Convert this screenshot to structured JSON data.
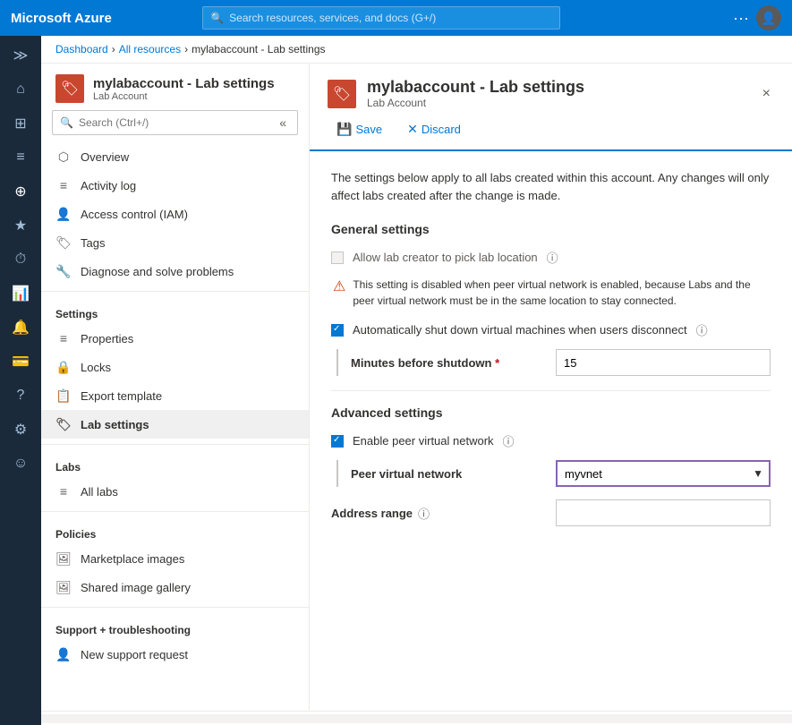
{
  "topbar": {
    "brand": "Microsoft Azure",
    "search_placeholder": "Search resources, services, and docs (G+/)"
  },
  "breadcrumb": {
    "items": [
      "Dashboard",
      "All resources",
      "mylabaccount - Lab settings"
    ]
  },
  "panel": {
    "title": "mylabaccount - Lab settings",
    "subtitle": "Lab Account",
    "close_label": "×"
  },
  "toolbar": {
    "save_label": "Save",
    "discard_label": "Discard"
  },
  "description": "The settings below apply to all labs created within this account. Any changes will only affect labs created after the change is made.",
  "general_settings": {
    "title": "General settings",
    "allow_lab_creator_label": "Allow lab creator to pick lab location",
    "warning_text": "This setting is disabled when peer virtual network is enabled, because Labs and the peer virtual network must be in the same location to stay connected.",
    "auto_shutdown_label": "Automatically shut down virtual machines when users disconnect",
    "minutes_label": "Minutes before shutdown",
    "minutes_required": true,
    "minutes_value": "15"
  },
  "advanced_settings": {
    "title": "Advanced settings",
    "enable_peer_vnet_label": "Enable peer virtual network",
    "peer_vnet_label": "Peer virtual network",
    "peer_vnet_value": "myvnet",
    "peer_vnet_options": [
      "myvnet"
    ],
    "address_range_label": "Address range",
    "address_range_value": ""
  },
  "sidebar": {
    "title": "mylabaccount - Lab settings",
    "subtitle": "Lab Account",
    "search_placeholder": "Search (Ctrl+/)",
    "items": [
      {
        "id": "overview",
        "label": "Overview",
        "icon": "⬡"
      },
      {
        "id": "activity-log",
        "label": "Activity log",
        "icon": "≡"
      },
      {
        "id": "access-control",
        "label": "Access control (IAM)",
        "icon": "👤"
      },
      {
        "id": "tags",
        "label": "Tags",
        "icon": "🏷"
      },
      {
        "id": "diagnose",
        "label": "Diagnose and solve problems",
        "icon": "🔧"
      }
    ],
    "settings_section": "Settings",
    "settings_items": [
      {
        "id": "properties",
        "label": "Properties",
        "icon": "≡"
      },
      {
        "id": "locks",
        "label": "Locks",
        "icon": "🔒"
      },
      {
        "id": "export-template",
        "label": "Export template",
        "icon": "📋"
      },
      {
        "id": "lab-settings",
        "label": "Lab settings",
        "icon": "🏷",
        "active": true
      }
    ],
    "labs_section": "Labs",
    "labs_items": [
      {
        "id": "all-labs",
        "label": "All labs",
        "icon": "≡"
      }
    ],
    "policies_section": "Policies",
    "policies_items": [
      {
        "id": "marketplace-images",
        "label": "Marketplace images",
        "icon": "🖼"
      },
      {
        "id": "shared-image-gallery",
        "label": "Shared image gallery",
        "icon": "🖼"
      }
    ],
    "support_section": "Support + troubleshooting",
    "support_items": [
      {
        "id": "new-support-request",
        "label": "New support request",
        "icon": "👤"
      }
    ]
  },
  "rail_icons": [
    {
      "id": "expand",
      "icon": "≫"
    },
    {
      "id": "home",
      "icon": "⌂"
    },
    {
      "id": "dashboard",
      "icon": "⊞"
    },
    {
      "id": "resource-groups",
      "icon": "≡"
    },
    {
      "id": "all-resources",
      "icon": "⊕"
    },
    {
      "id": "favorites",
      "icon": "★"
    },
    {
      "id": "recent",
      "icon": "⏱"
    },
    {
      "id": "monitor",
      "icon": "📊"
    },
    {
      "id": "security",
      "icon": "🔔"
    },
    {
      "id": "cost",
      "icon": "💰"
    },
    {
      "id": "help",
      "icon": "?"
    },
    {
      "id": "settings2",
      "icon": "⚙"
    },
    {
      "id": "feedback",
      "icon": "😊"
    }
  ]
}
